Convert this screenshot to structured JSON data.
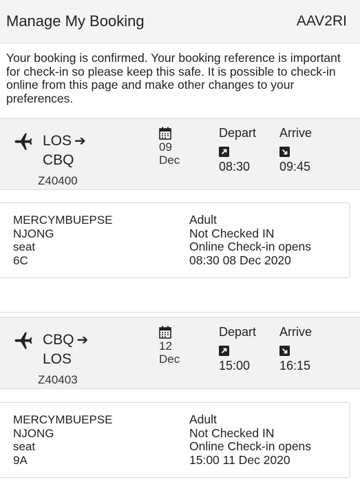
{
  "header": {
    "title": "Manage My Booking",
    "reference": "AAV2RI"
  },
  "intro": "Your booking is confirmed. Your booking reference is important for check-in so please keep this safe. It is possible to check-in online from this page and make other changes to your preferences.",
  "flights": [
    {
      "origin": "LOS",
      "destination": "CBQ",
      "flight_number": "Z40400",
      "day": "09",
      "month": "Dec",
      "depart_label": "Depart",
      "depart_time": "08:30",
      "arrive_label": "Arrive",
      "arrive_time": "09:45",
      "passenger": {
        "first_name": "MERCYMBUEPSE",
        "last_name": "NJONG",
        "seat_label": "seat",
        "seat": "6C",
        "type": "Adult",
        "status": "Not Checked IN",
        "checkin_label": "Online Check-in opens",
        "checkin_time": "08:30 08 Dec 2020"
      }
    },
    {
      "origin": "CBQ",
      "destination": "LOS",
      "flight_number": "Z40403",
      "day": "12",
      "month": "Dec",
      "depart_label": "Depart",
      "depart_time": "15:00",
      "arrive_label": "Arrive",
      "arrive_time": "16:15",
      "passenger": {
        "first_name": "MERCYMBUEPSE",
        "last_name": "NJONG",
        "seat_label": "seat",
        "seat": "9A",
        "type": "Adult",
        "status": "Not Checked IN",
        "checkin_label": "Online Check-in opens",
        "checkin_time": "15:00 11 Dec 2020"
      }
    }
  ],
  "icons": {
    "plane": "airplane-icon",
    "route_arrow": "arrow-right-icon",
    "calendar": "calendar-icon",
    "depart": "arrow-up-right-icon",
    "arrive": "arrow-down-right-icon"
  }
}
